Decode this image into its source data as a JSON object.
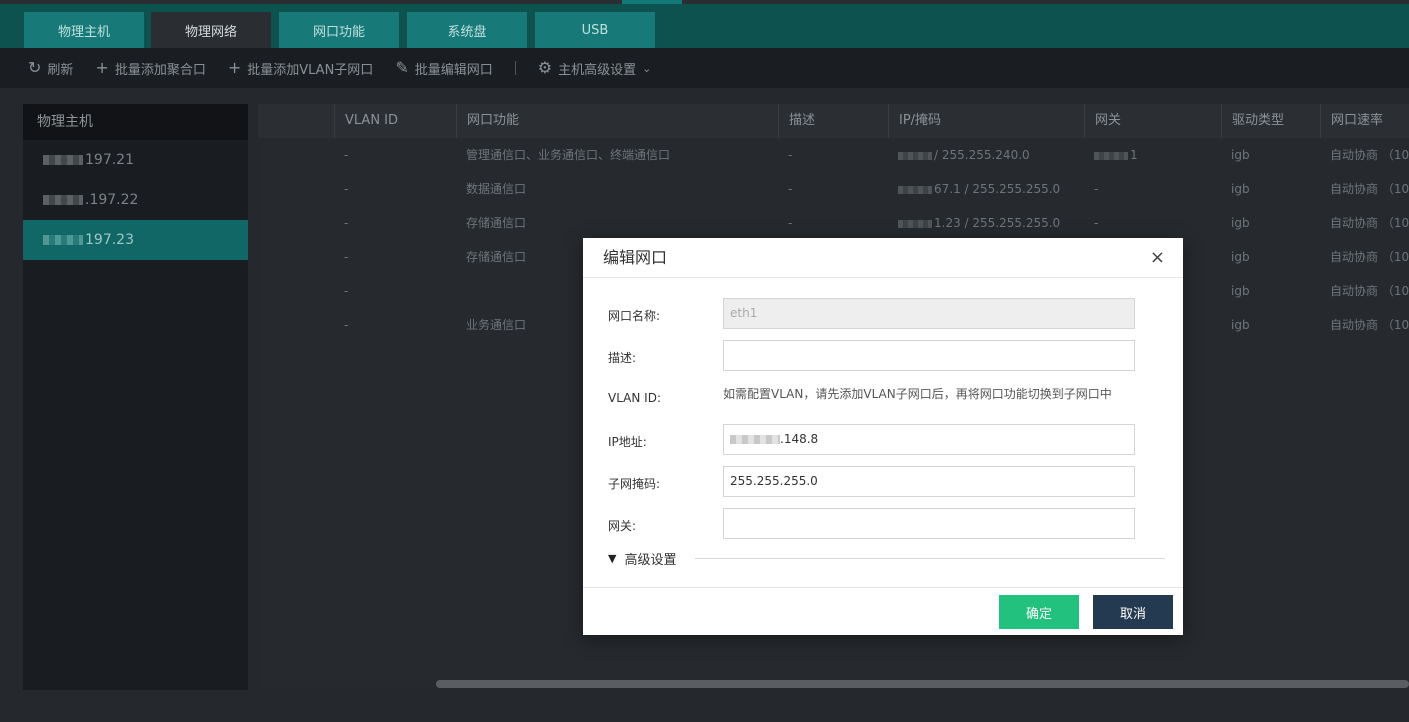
{
  "tabs": [
    {
      "label": "物理主机",
      "active": false
    },
    {
      "label": "物理网络",
      "active": true
    },
    {
      "label": "网口功能",
      "active": false
    },
    {
      "label": "系统盘",
      "active": false
    },
    {
      "label": "USB",
      "active": false
    }
  ],
  "toolbar": {
    "refresh": "刷新",
    "add_bond": "批量添加聚合口",
    "add_vlan": "批量添加VLAN子网口",
    "edit_ports": "批量编辑网口",
    "advanced": "主机高级设置"
  },
  "sidebar": {
    "header": "物理主机",
    "hosts": [
      {
        "suffix": "197.21",
        "active": false
      },
      {
        "suffix": ".197.22",
        "active": false
      },
      {
        "suffix": "197.23",
        "active": true
      }
    ]
  },
  "table": {
    "headers": [
      "VLAN ID",
      "网口功能",
      "描述",
      "IP/掩码",
      "网关",
      "驱动类型",
      "网口速率"
    ],
    "rows": [
      {
        "vlan": "-",
        "func": "管理通信口、业务通信口、终端通信口",
        "desc": "-",
        "ip": "/ 255.255.240.0",
        "gw": "1",
        "driver": "igb",
        "speed": "自动协商 （10"
      },
      {
        "vlan": "-",
        "func": "数据通信口",
        "desc": "-",
        "ip": "67.1 / 255.255.255.0",
        "gw": "-",
        "driver": "igb",
        "speed": "自动协商 （10"
      },
      {
        "vlan": "-",
        "func": "存储通信口",
        "desc": "-",
        "ip": "1.23 / 255.255.255.0",
        "gw": "-",
        "driver": "igb",
        "speed": "自动协商 （10"
      },
      {
        "vlan": "-",
        "func": "存储通信口",
        "desc": "",
        "ip": "",
        "gw": "",
        "driver": "igb",
        "speed": "自动协商 （10"
      },
      {
        "vlan": "-",
        "func": "",
        "desc": "",
        "ip": "",
        "gw": "",
        "driver": "igb",
        "speed": "自动协商 （10"
      },
      {
        "vlan": "-",
        "func": "业务通信口",
        "desc": "",
        "ip": "",
        "gw": "",
        "driver": "igb",
        "speed": "自动协商 （10"
      }
    ]
  },
  "dialog": {
    "title": "编辑网口",
    "close": "×",
    "fields": {
      "name_label": "网口名称:",
      "name_value": "eth1",
      "desc_label": "描述:",
      "desc_value": "",
      "vlan_label": "VLAN ID:",
      "vlan_hint": "如需配置VLAN，请先添加VLAN子网口后，再将网口功能切换到子网口中",
      "ip_label": "IP地址:",
      "ip_value": ".148.8",
      "mask_label": "子网掩码:",
      "mask_value": "255.255.255.0",
      "gw_label": "网关:",
      "gw_value": ""
    },
    "advanced": "高级设置",
    "ok": "确定",
    "cancel": "取消"
  },
  "colors": {
    "tab_bar": "#0e5250",
    "accent_teal": "#116766",
    "ok_button": "#22c27e",
    "cancel_button": "#233a50"
  }
}
